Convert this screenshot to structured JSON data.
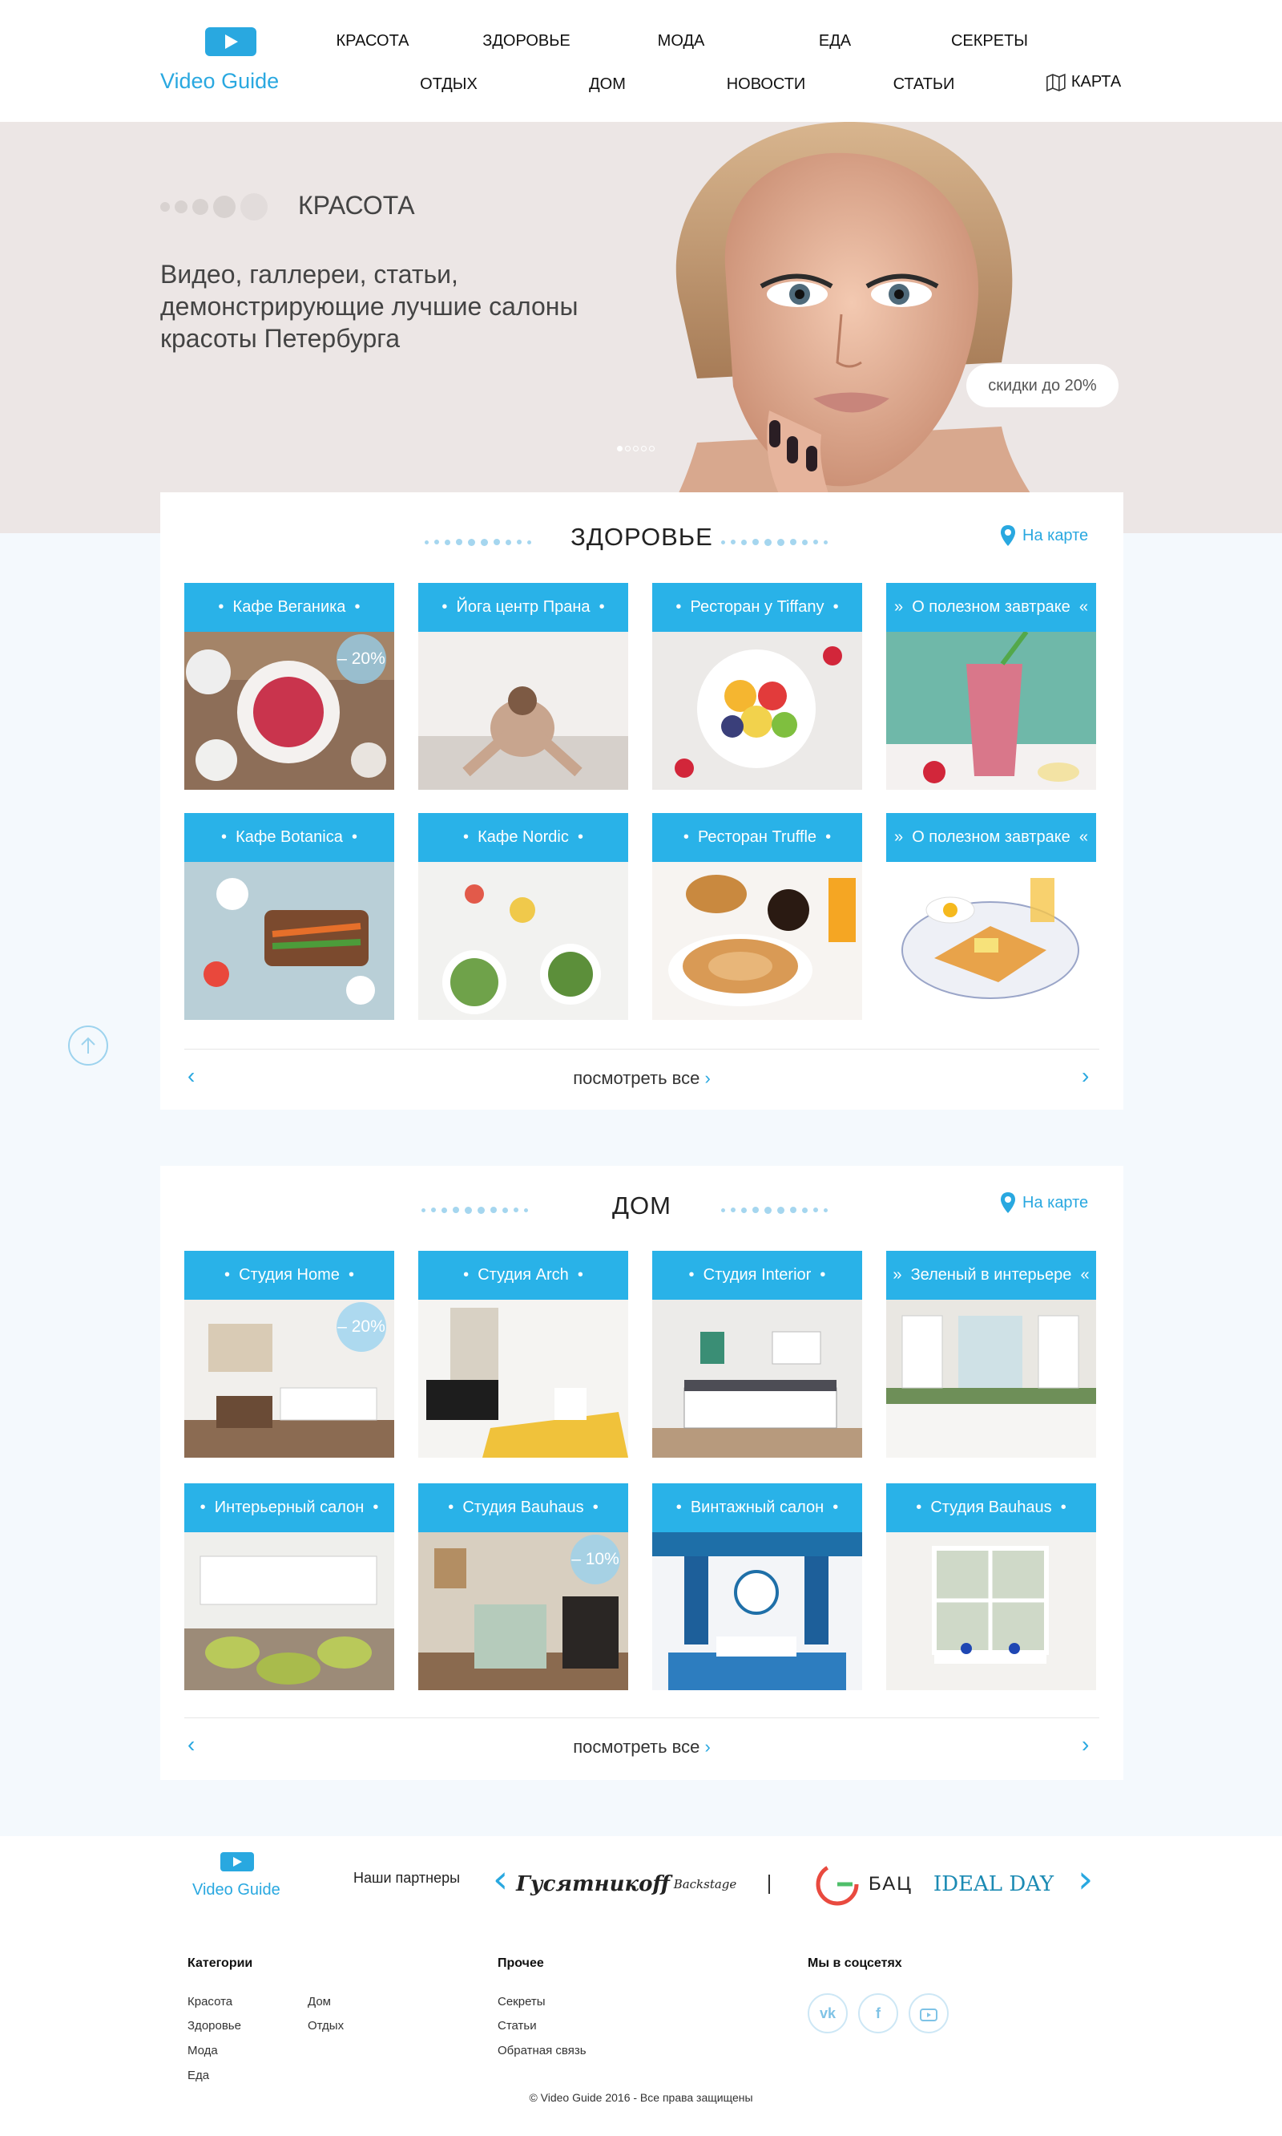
{
  "header": {
    "logo": "Video Guide",
    "nav_row1": [
      "КРАСОТА",
      "ЗДОРОВЬЕ",
      "МОДА",
      "ЕДА",
      "СЕКРЕТЫ"
    ],
    "nav_row2": [
      "ОТДЫХ",
      "ДОМ",
      "НОВОСТИ",
      "СТАТЬИ",
      "КАРТА"
    ]
  },
  "hero": {
    "category": "КРАСОТА",
    "description": "Видео, галлереи, статьи, демонстрирующие лучшие салоны красоты Петербурга",
    "badge": "скидки до 20%"
  },
  "sections": [
    {
      "title": "ЗДОРОВЬЕ",
      "map_link": "На карте",
      "cards": [
        {
          "label": "Кафе Веганика",
          "discount": "– 20%"
        },
        {
          "label": "Йога центр Прана"
        },
        {
          "label": "Ресторан у Tiffany"
        },
        {
          "label": "О полезном завтраке"
        },
        {
          "label": "Кафе Botanica"
        },
        {
          "label": "Кафе Nordic"
        },
        {
          "label": "Ресторан Truffle"
        },
        {
          "label": "О полезном завтраке"
        }
      ],
      "view_all": "посмотреть все"
    },
    {
      "title": "ДОМ",
      "map_link": "На карте",
      "cards": [
        {
          "label": "Студия Home",
          "discount": "– 20%"
        },
        {
          "label": "Студия Arch"
        },
        {
          "label": "Студия Interior"
        },
        {
          "label": "Зеленый в интерьере"
        },
        {
          "label": "Интерьерный салон"
        },
        {
          "label": "Студия Bauhaus",
          "discount": "– 10%"
        },
        {
          "label": "Винтажный салон"
        },
        {
          "label": "Студия Bauhaus"
        }
      ],
      "view_all": "посмотреть все"
    }
  ],
  "partners": {
    "logo": "Video Guide",
    "label": "Наши партнеры",
    "items": [
      "Гусятникоff",
      "Backstage",
      "БАЦ",
      "IDEAL DAY"
    ]
  },
  "footer": {
    "categories_title": "Категории",
    "categories_col1": [
      "Красота",
      "Здоровье",
      "Мода",
      "Еда"
    ],
    "categories_col2": [
      "Дом",
      "Отдых"
    ],
    "other_title": "Прочее",
    "other": [
      "Секреты",
      "Статьи",
      "Обратная связь"
    ],
    "social_title": "Мы в соцсетях",
    "social": [
      "vk-icon",
      "facebook-icon",
      "youtube-icon"
    ],
    "copyright": "© Video Guide  2016 - Все права защищены"
  },
  "colors": {
    "accent": "#29b2e8",
    "hero_bg": "#ece6e5",
    "page_bg": "#f4f9fd"
  }
}
